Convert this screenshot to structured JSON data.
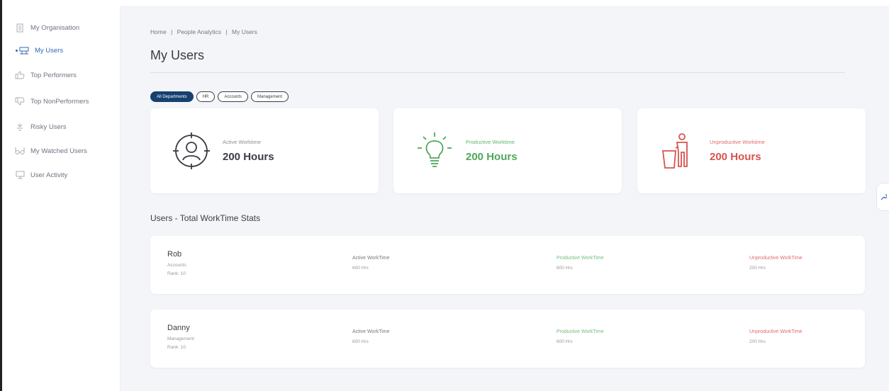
{
  "sidebar": {
    "items": [
      {
        "label": "My Organisation",
        "icon": "building-icon"
      },
      {
        "label": "My Users",
        "icon": "users-icon"
      },
      {
        "label": "Top Performers",
        "icon": "thumbs-up-icon"
      },
      {
        "label": "Top NonPerformers",
        "icon": "thumbs-down-icon"
      },
      {
        "label": "Risky Users",
        "icon": "warning-icon"
      },
      {
        "label": "My Watched Users",
        "icon": "binoculars-icon"
      },
      {
        "label": "User Activity",
        "icon": "monitor-icon"
      }
    ],
    "active_index": 1
  },
  "breadcrumb": {
    "home": "Home",
    "sep": "|",
    "section": "People Analytics",
    "current": "My Users"
  },
  "page": {
    "title": "My Users"
  },
  "filters": [
    "All Departments",
    "HR",
    "Accounts",
    "Management"
  ],
  "cards": [
    {
      "label": "Active Worktime",
      "value": "200 Hours"
    },
    {
      "label": "Productive Worktime",
      "value": "200 Hours"
    },
    {
      "label": "Unproductive Worktime",
      "value": "200 Hours"
    }
  ],
  "section": {
    "title": "Users - Total WorkTime Stats"
  },
  "users": [
    {
      "name": "Rob",
      "department": "Accounts",
      "rank": "Rank: 10",
      "active_label": "Active WorkTime",
      "active_value": "600 Hrs",
      "productive_label": "Productive WorkTime",
      "productive_value": "600 Hrs",
      "unproductive_label": "Unproductive WorkTime",
      "unproductive_value": "200 Hrs"
    },
    {
      "name": "Danny",
      "department": "Management",
      "rank": "Rank: 10",
      "active_label": "Active WorkTime",
      "active_value": "600 Hrs",
      "productive_label": "Productive WorkTime",
      "productive_value": "600 Hrs",
      "unproductive_label": "Unproductive WorkTime",
      "unproductive_value": "200 Hrs"
    }
  ],
  "colors": {
    "accent": "#2f6ab3",
    "pill_active": "#16406f",
    "green": "#4fa85b",
    "red": "#d9534f",
    "background": "#f4f5f8"
  }
}
